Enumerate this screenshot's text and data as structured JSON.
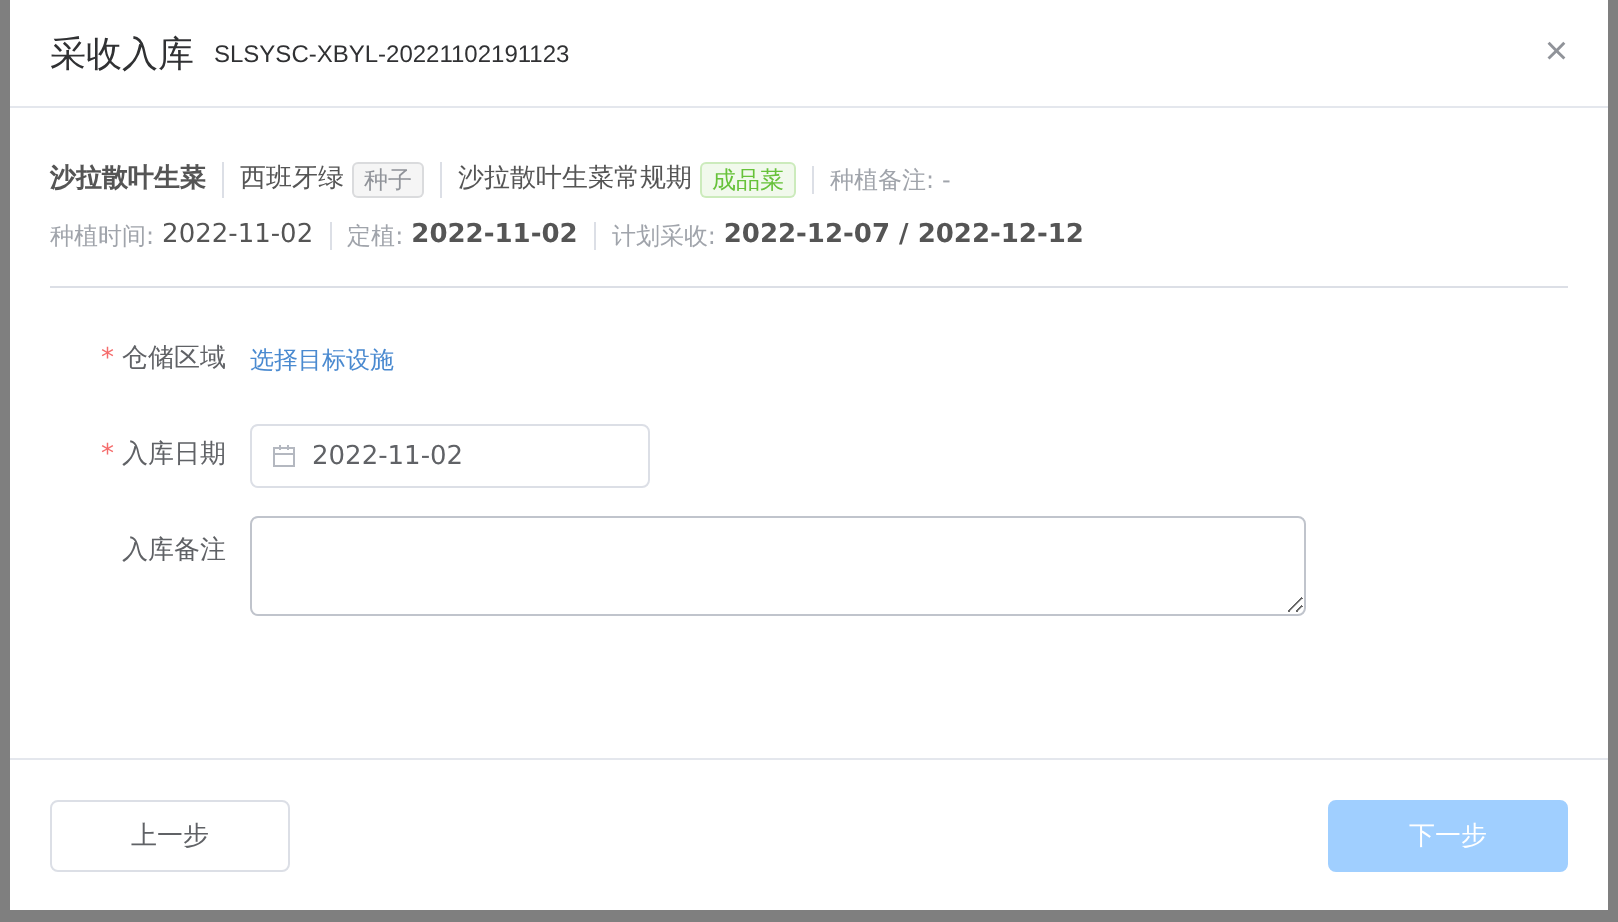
{
  "dialog": {
    "title": "采收入库",
    "code": "SLSYSC-XBYL-20221102191123",
    "close": "×"
  },
  "info_rows": [
    [
      [
        {
          "kind": "strong",
          "text": "沙拉散叶生菜"
        }
      ],
      [
        {
          "kind": "plain",
          "text": "西班牙绿"
        },
        {
          "kind": "tag",
          "text": "种子",
          "color": "#909399"
        }
      ],
      [
        {
          "kind": "plain",
          "text": "沙拉散叶生菜常规期"
        },
        {
          "kind": "tag",
          "text": "成品菜",
          "color": "#67c23a"
        }
      ],
      [
        {
          "kind": "label",
          "text": "种植备注:"
        },
        {
          "kind": "muted",
          "text": "-"
        }
      ]
    ],
    [
      [
        {
          "kind": "label",
          "text": "种植时间:"
        },
        {
          "kind": "plain",
          "text": "2022-11-02"
        }
      ],
      [
        {
          "kind": "label",
          "text": "定植:"
        },
        {
          "kind": "strong",
          "text": "2022-11-02"
        }
      ],
      [
        {
          "kind": "label",
          "text": "计划采收:"
        },
        {
          "kind": "strong",
          "text": "2022-12-07 / 2022-12-12"
        }
      ]
    ]
  ],
  "form": [
    {
      "kind": "link",
      "label": "仓储区域",
      "required_mark": "*",
      "value": "选择目标设施"
    },
    {
      "kind": "date",
      "label": "入库日期",
      "required_mark": "*",
      "value": "2022-11-02"
    },
    {
      "kind": "textarea",
      "label": "入库备注"
    }
  ],
  "buttons": [
    {
      "label": "上一步",
      "primary": false,
      "disabled": false
    },
    {
      "label": "下一步",
      "primary": true,
      "disabled": true
    }
  ]
}
